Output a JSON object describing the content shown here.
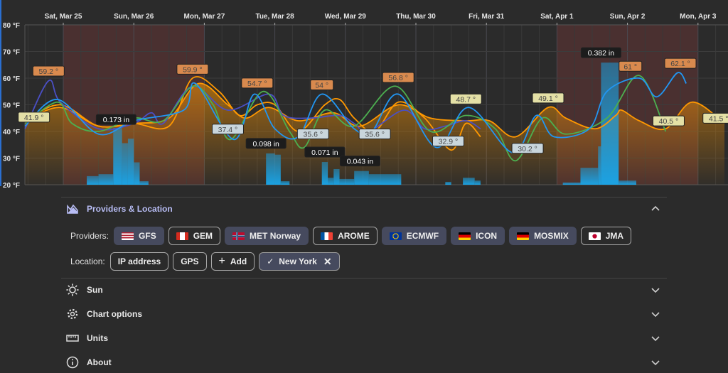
{
  "chart_data": {
    "type": "line",
    "x_axis": {
      "ticks": [
        {
          "date": "Mar 25 00:00",
          "label": "Sat, Mar 25"
        },
        {
          "date": "Mar 26 00:00",
          "label": "Sun, Mar 26"
        },
        {
          "date": "Mar 27 00:00",
          "label": "Mon, Mar 27"
        },
        {
          "date": "Mar 28 00:00",
          "label": "Tue, Mar 28"
        },
        {
          "date": "Mar 29 00:00",
          "label": "Wed, Mar 29"
        },
        {
          "date": "Mar 30 00:00",
          "label": "Thu, Mar 30"
        },
        {
          "date": "Mar 31 00:00",
          "label": "Fri, Mar 31"
        },
        {
          "date": "Apr 1 00:00",
          "label": "Sat, Apr 1"
        },
        {
          "date": "Apr 2 00:00",
          "label": "Sun, Apr 2"
        },
        {
          "date": "Apr 3 00:00",
          "label": "Mon, Apr 3"
        }
      ],
      "range": [
        "Mar 24 11:00",
        "Apr 3 09:00"
      ]
    },
    "y_axis": {
      "unit": "°F",
      "ylim": [
        20,
        80
      ],
      "ticks": [
        "20 °F",
        "30 °F",
        "40 °F",
        "50 °F",
        "60 °F",
        "70 °F",
        "80 °F"
      ]
    },
    "precip_axis": {
      "unit": "in",
      "ylim": [
        0,
        0.5
      ]
    },
    "grid": true,
    "weekend_highlight": [
      [
        "Mar 25 00:00",
        "Mar 27 00:00"
      ],
      [
        "Apr 1 00:00",
        "Apr 3 00:00"
      ]
    ],
    "highlight_color": "#4a3030",
    "series": [
      {
        "color": "#ff9800",
        "fill": true,
        "points": [
          [
            "Mar 24 11:00",
            44
          ],
          [
            "Mar 24 23:00",
            49
          ],
          [
            "Mar 25 12:00",
            42
          ],
          [
            "Mar 26 00:00",
            43
          ],
          [
            "Mar 26 12:00",
            45
          ],
          [
            "Mar 26 22:00",
            58
          ],
          [
            "Mar 27 08:00",
            50
          ],
          [
            "Mar 27 14:00",
            45
          ],
          [
            "Mar 27 22:00",
            49
          ],
          [
            "Mar 28 08:00",
            44
          ],
          [
            "Mar 28 20:00",
            47
          ],
          [
            "Mar 29 05:00",
            42
          ],
          [
            "Mar 29 18:00",
            50
          ],
          [
            "Mar 30 05:00",
            45
          ],
          [
            "Mar 30 17:00",
            44
          ],
          [
            "Mar 31 01:00",
            44
          ],
          [
            "Mar 31 10:00",
            38
          ],
          [
            "Mar 31 21:00",
            49
          ],
          [
            "Apr 1 03:00",
            45
          ],
          [
            "Apr 1 13:00",
            41
          ],
          [
            "Apr 1 20:00",
            46
          ],
          [
            "Apr 1 22:00",
            48
          ],
          [
            "Apr 2 04:00",
            44
          ],
          [
            "Apr 2 13:00",
            41
          ],
          [
            "Apr 2 22:00",
            51
          ],
          [
            "Apr 3 09:00",
            43
          ]
        ]
      },
      {
        "color": "#ff9800",
        "fill": false,
        "points": [
          [
            "Mar 24 11:00",
            44
          ],
          [
            "Mar 24 23:00",
            50
          ],
          [
            "Mar 25 12:00",
            42
          ],
          [
            "Mar 26 00:00",
            43
          ],
          [
            "Mar 26 12:00",
            42
          ],
          [
            "Mar 26 20:00",
            60
          ],
          [
            "Mar 27 05:00",
            55
          ],
          [
            "Mar 27 12:00",
            46
          ],
          [
            "Mar 27 18:00",
            50
          ],
          [
            "Mar 28 00:00",
            50
          ],
          [
            "Mar 28 08:00",
            40
          ],
          [
            "Mar 28 17:00",
            50
          ],
          [
            "Mar 28 22:00",
            52
          ],
          [
            "Mar 29 03:00",
            45
          ],
          [
            "Mar 29 10:00",
            40
          ],
          [
            "Mar 29 18:00",
            51
          ],
          [
            "Mar 30 03:00",
            45
          ],
          [
            "Mar 30 12:00",
            33
          ],
          [
            "Mar 30 17:00",
            43
          ],
          [
            "Mar 30 22:00",
            38
          ]
        ]
      },
      {
        "color": "#4a4fc4",
        "fill": false,
        "points": [
          [
            "Mar 24 11:00",
            41
          ],
          [
            "Mar 24 19:00",
            59
          ],
          [
            "Mar 24 23:00",
            51
          ],
          [
            "Mar 25 12:00",
            41
          ],
          [
            "Mar 26 00:00",
            43
          ],
          [
            "Mar 26 06:00",
            47
          ],
          [
            "Mar 26 10:00",
            43
          ],
          [
            "Mar 26 20:00",
            57
          ],
          [
            "Mar 27 08:00",
            48
          ],
          [
            "Mar 27 22:00",
            54
          ],
          [
            "Mar 28 03:00",
            46
          ],
          [
            "Mar 28 12:00",
            45
          ],
          [
            "Mar 28 22:00",
            46
          ],
          [
            "Mar 29 03:00",
            43
          ],
          [
            "Mar 29 08:00",
            40
          ],
          [
            "Mar 29 20:00",
            48
          ],
          [
            "Mar 30 03:00",
            41
          ],
          [
            "Mar 30 10:00",
            42
          ],
          [
            "Mar 30 17:00",
            44
          ],
          [
            "Mar 30 22:00",
            41
          ]
        ]
      },
      {
        "color": "#4caf50",
        "fill": false,
        "points": [
          [
            "Mar 24 11:00",
            43
          ],
          [
            "Mar 24 22:00",
            51
          ],
          [
            "Mar 25 03:00",
            43
          ],
          [
            "Mar 25 12:00",
            40
          ],
          [
            "Mar 26 00:00",
            45
          ],
          [
            "Mar 26 10:00",
            44
          ],
          [
            "Mar 26 20:00",
            57
          ],
          [
            "Mar 27 03:00",
            50
          ],
          [
            "Mar 27 09:00",
            37
          ],
          [
            "Mar 27 20:00",
            55
          ],
          [
            "Mar 28 05:00",
            40
          ],
          [
            "Mar 28 10:00",
            34
          ],
          [
            "Mar 28 17:00",
            48
          ],
          [
            "Mar 29 03:00",
            42
          ],
          [
            "Mar 29 17:00",
            57
          ],
          [
            "Mar 30 05:00",
            40
          ],
          [
            "Mar 30 17:00",
            46
          ],
          [
            "Mar 31 03:00",
            41
          ],
          [
            "Mar 31 10:00",
            29
          ],
          [
            "Mar 31 19:00",
            45
          ],
          [
            "Apr 1 03:00",
            39
          ],
          [
            "Apr 1 17:00",
            45
          ],
          [
            "Apr 2 04:00",
            61
          ],
          [
            "Apr 2 13:00",
            40
          ]
        ]
      },
      {
        "color": "#2196f3",
        "fill": false,
        "points": [
          [
            "Mar 24 11:00",
            42
          ],
          [
            "Mar 24 22:00",
            52
          ],
          [
            "Mar 25 12:00",
            39
          ],
          [
            "Mar 26 00:00",
            44
          ],
          [
            "Mar 26 17:00",
            48
          ],
          [
            "Mar 26 21:00",
            58
          ],
          [
            "Mar 27 10:00",
            37
          ],
          [
            "Mar 27 17:00",
            54
          ],
          [
            "Mar 28 00:00",
            41
          ],
          [
            "Mar 28 08:00",
            38
          ],
          [
            "Mar 28 16:00",
            54
          ],
          [
            "Mar 29 03:00",
            41
          ],
          [
            "Mar 29 09:00",
            40
          ],
          [
            "Mar 29 18:00",
            54
          ],
          [
            "Mar 30 07:00",
            34
          ],
          [
            "Mar 30 18:00",
            49
          ],
          [
            "Mar 31 09:00",
            32
          ],
          [
            "Mar 31 17:00",
            46
          ],
          [
            "Mar 31 23:00",
            38
          ],
          [
            "Apr 1 11:00",
            41
          ],
          [
            "Apr 1 17:00",
            55
          ],
          [
            "Apr 2 04:00",
            60
          ],
          [
            "Apr 2 10:00",
            53
          ],
          [
            "Apr 2 17:00",
            62
          ],
          [
            "Apr 2 20:00",
            58
          ]
        ]
      }
    ],
    "precip_color": "#1e9bd7",
    "precipitation": [
      [
        "Mar 25 08:00",
        "Mar 25 12:00",
        0.027
      ],
      [
        "Mar 25 12:00",
        "Mar 25 17:00",
        0.033
      ],
      [
        "Mar 25 17:00",
        "Mar 25 20:00",
        0.178
      ],
      [
        "Mar 25 20:00",
        "Mar 25 22:00",
        0.13
      ],
      [
        "Mar 25 22:00",
        "Mar 26 00:00",
        0.144
      ],
      [
        "Mar 26 00:00",
        "Mar 26 02:00",
        0.07
      ],
      [
        "Mar 26 02:00",
        "Mar 26 05:00",
        0.011
      ],
      [
        "Mar 27 21:00",
        "Mar 28 00:00",
        0.098
      ],
      [
        "Mar 28 00:00",
        "Mar 28 02:00",
        0.094
      ],
      [
        "Mar 28 02:00",
        "Mar 28 05:00",
        0.011
      ],
      [
        "Mar 28 16:00",
        "Mar 28 18:00",
        0.071
      ],
      [
        "Mar 28 18:00",
        "Mar 28 20:00",
        0.022
      ],
      [
        "Mar 28 20:00",
        "Mar 28 22:00",
        0.049
      ],
      [
        "Mar 28 22:00",
        "Mar 29 03:00",
        0.018
      ],
      [
        "Mar 29 03:00",
        "Mar 29 08:00",
        0.043
      ],
      [
        "Mar 29 08:00",
        "Mar 29 19:00",
        0.033
      ],
      [
        "Mar 30 10:00",
        "Mar 30 12:00",
        0.009
      ],
      [
        "Mar 30 16:00",
        "Mar 30 20:00",
        0.022
      ],
      [
        "Mar 30 20:00",
        "Mar 30 22:00",
        0.013
      ],
      [
        "Apr 1 02:00",
        "Apr 1 08:00",
        0.007
      ],
      [
        "Apr 1 08:00",
        "Apr 1 14:00",
        0.053
      ],
      [
        "Apr 1 14:00",
        "Apr 1 15:00",
        0.12
      ],
      [
        "Apr 1 15:00",
        "Apr 1 21:00",
        0.382
      ],
      [
        "Apr 1 21:00",
        "Apr 2 03:00",
        0.013
      ]
    ],
    "temp_labels": [
      {
        "kind": "max",
        "date": "Mar 24 19:00",
        "value": 59.2,
        "text": "59.2 °"
      },
      {
        "kind": "max",
        "date": "Mar 26 20:00",
        "value": 59.9,
        "text": "59.9 °"
      },
      {
        "kind": "max",
        "date": "Mar 27 18:00",
        "value": 54.7,
        "text": "54.7 °"
      },
      {
        "kind": "max",
        "date": "Mar 28 16:00",
        "value": 54,
        "text": "54 °"
      },
      {
        "kind": "max",
        "date": "Mar 29 18:00",
        "value": 56.8,
        "text": "56.8 °"
      },
      {
        "kind": "max",
        "date": "Apr 2 01:00",
        "value": 61,
        "text": "61 °"
      },
      {
        "kind": "max",
        "date": "Apr 2 18:00",
        "value": 62.1,
        "text": "62.1 °"
      },
      {
        "kind": "mid",
        "date": "Mar 24 14:00",
        "value": 41.9,
        "text": "41.9 °"
      },
      {
        "kind": "mid",
        "date": "Mar 30 17:00",
        "value": 48.7,
        "text": "48.7 °"
      },
      {
        "kind": "mid",
        "date": "Mar 31 21:00",
        "value": 49.1,
        "text": "49.1 °"
      },
      {
        "kind": "mid",
        "date": "Apr 2 14:00",
        "value": 40.5,
        "text": "40.5 °"
      },
      {
        "kind": "mid",
        "date": "Apr 3 07:00",
        "value": 41.5,
        "text": "41.5 °"
      },
      {
        "kind": "min",
        "date": "Mar 27 08:00",
        "value": 37.4,
        "text": "37.4 °"
      },
      {
        "kind": "min",
        "date": "Mar 28 13:00",
        "value": 35.6,
        "text": "35.6 °"
      },
      {
        "kind": "min",
        "date": "Mar 29 10:00",
        "value": 35.6,
        "text": "35.6 °"
      },
      {
        "kind": "min",
        "date": "Mar 30 11:00",
        "value": 32.9,
        "text": "32.9 °"
      },
      {
        "kind": "min",
        "date": "Mar 31 14:00",
        "value": 30.2,
        "text": "30.2 °"
      }
    ],
    "label_colors": {
      "max": "#d98a4e",
      "mid": "#e4e0a6",
      "min": "#c9d6dc"
    },
    "precip_labels": [
      {
        "date": "Mar 25 18:00",
        "value": 0.173,
        "text": "0.173 in"
      },
      {
        "date": "Mar 27 21:00",
        "value": 0.098,
        "text": "0.098 in"
      },
      {
        "date": "Mar 28 17:00",
        "value": 0.071,
        "text": "0.071 in"
      },
      {
        "date": "Mar 29 05:00",
        "value": 0.043,
        "text": "0.043 in"
      },
      {
        "date": "Apr 1 15:00",
        "value": 0.382,
        "text": "0.382 in"
      }
    ]
  },
  "providers_section": {
    "title": "Providers & Location",
    "icon": "mountain-chart-icon",
    "expanded": true,
    "providers_label": "Providers:",
    "providers": [
      {
        "name": "GFS",
        "flag": "us",
        "selected": true
      },
      {
        "name": "GEM",
        "flag": "ca",
        "selected": false
      },
      {
        "name": "MET Norway",
        "flag": "no",
        "selected": true
      },
      {
        "name": "AROME",
        "flag": "fr",
        "selected": false
      },
      {
        "name": "ECMWF",
        "flag": "eu",
        "selected": true
      },
      {
        "name": "ICON",
        "flag": "de",
        "selected": true
      },
      {
        "name": "MOSMIX",
        "flag": "de",
        "selected": true
      },
      {
        "name": "JMA",
        "flag": "jp",
        "selected": false
      }
    ],
    "location_label": "Location:",
    "location_buttons": [
      "IP address",
      "GPS"
    ],
    "add_label": "Add",
    "selected_location": "New York"
  },
  "sections": [
    {
      "title": "Sun",
      "icon": "sun-icon"
    },
    {
      "title": "Chart options",
      "icon": "gear-icon"
    },
    {
      "title": "Units",
      "icon": "ruler-icon"
    },
    {
      "title": "About",
      "icon": "info-icon"
    }
  ]
}
